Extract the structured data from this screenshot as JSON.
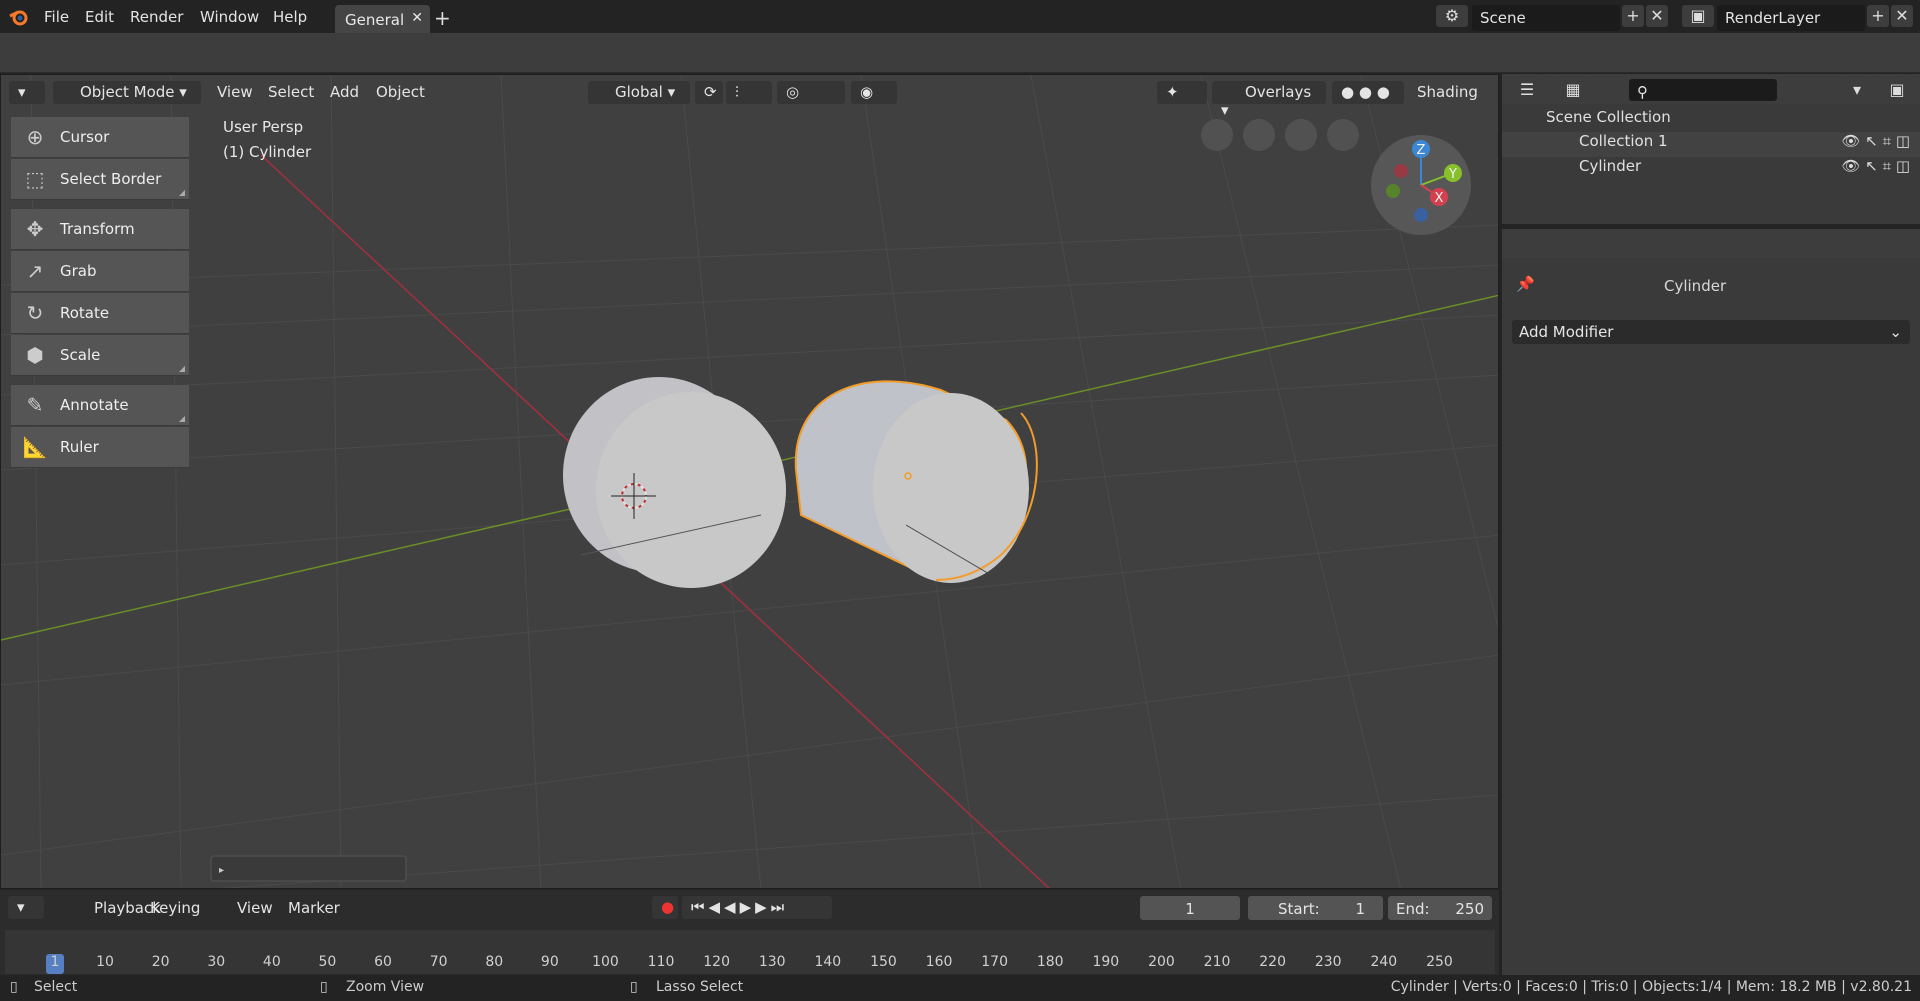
{
  "menubar": {
    "items": [
      "File",
      "Edit",
      "Render",
      "Window",
      "Help"
    ],
    "workspace_tab": "General",
    "scene": "Scene",
    "render_layer": "RenderLayer"
  },
  "viewport_header": {
    "mode": "Object Mode",
    "menus": [
      "View",
      "Select",
      "Add",
      "Object"
    ],
    "orientation": "Global",
    "overlays": "Overlays",
    "shading": "Shading"
  },
  "toolbar": {
    "cursor": "Cursor",
    "select_border": "Select Border",
    "transform": "Transform",
    "grab": "Grab",
    "rotate": "Rotate",
    "scale": "Scale",
    "annotate": "Annotate",
    "ruler": "Ruler"
  },
  "viewport": {
    "view_name": "User Persp",
    "active_object": "(1) Cylinder"
  },
  "gizmo": {
    "z": "Z",
    "y": "Y",
    "x": "X"
  },
  "outliner": {
    "scene_collection": "Scene Collection",
    "collection": "Collection 1",
    "object": "Cylinder"
  },
  "properties": {
    "object_name": "Cylinder",
    "add_modifier": "Add Modifier"
  },
  "timeline": {
    "menus": [
      "Playback",
      "Keying",
      "View",
      "Marker"
    ],
    "current_frame": "1",
    "start_label": "Start:",
    "start": "1",
    "end_label": "End:",
    "end": "250",
    "ticks": [
      "1",
      "10",
      "20",
      "30",
      "40",
      "50",
      "60",
      "70",
      "80",
      "90",
      "100",
      "110",
      "120",
      "130",
      "140",
      "150",
      "160",
      "170",
      "180",
      "190",
      "200",
      "210",
      "220",
      "230",
      "240",
      "250"
    ]
  },
  "statusbar": {
    "select": "Select",
    "zoom": "Zoom View",
    "lasso": "Lasso Select",
    "info": "Cylinder | Verts:0 | Faces:0 | Tris:0 | Objects:1/4 | Mem: 18.2 MB | v2.80.21"
  },
  "colors": {
    "accent": "#f39c2a",
    "x_axis": "#a52f3c",
    "y_axis": "#6a8f26",
    "selection": "#5680c2"
  }
}
